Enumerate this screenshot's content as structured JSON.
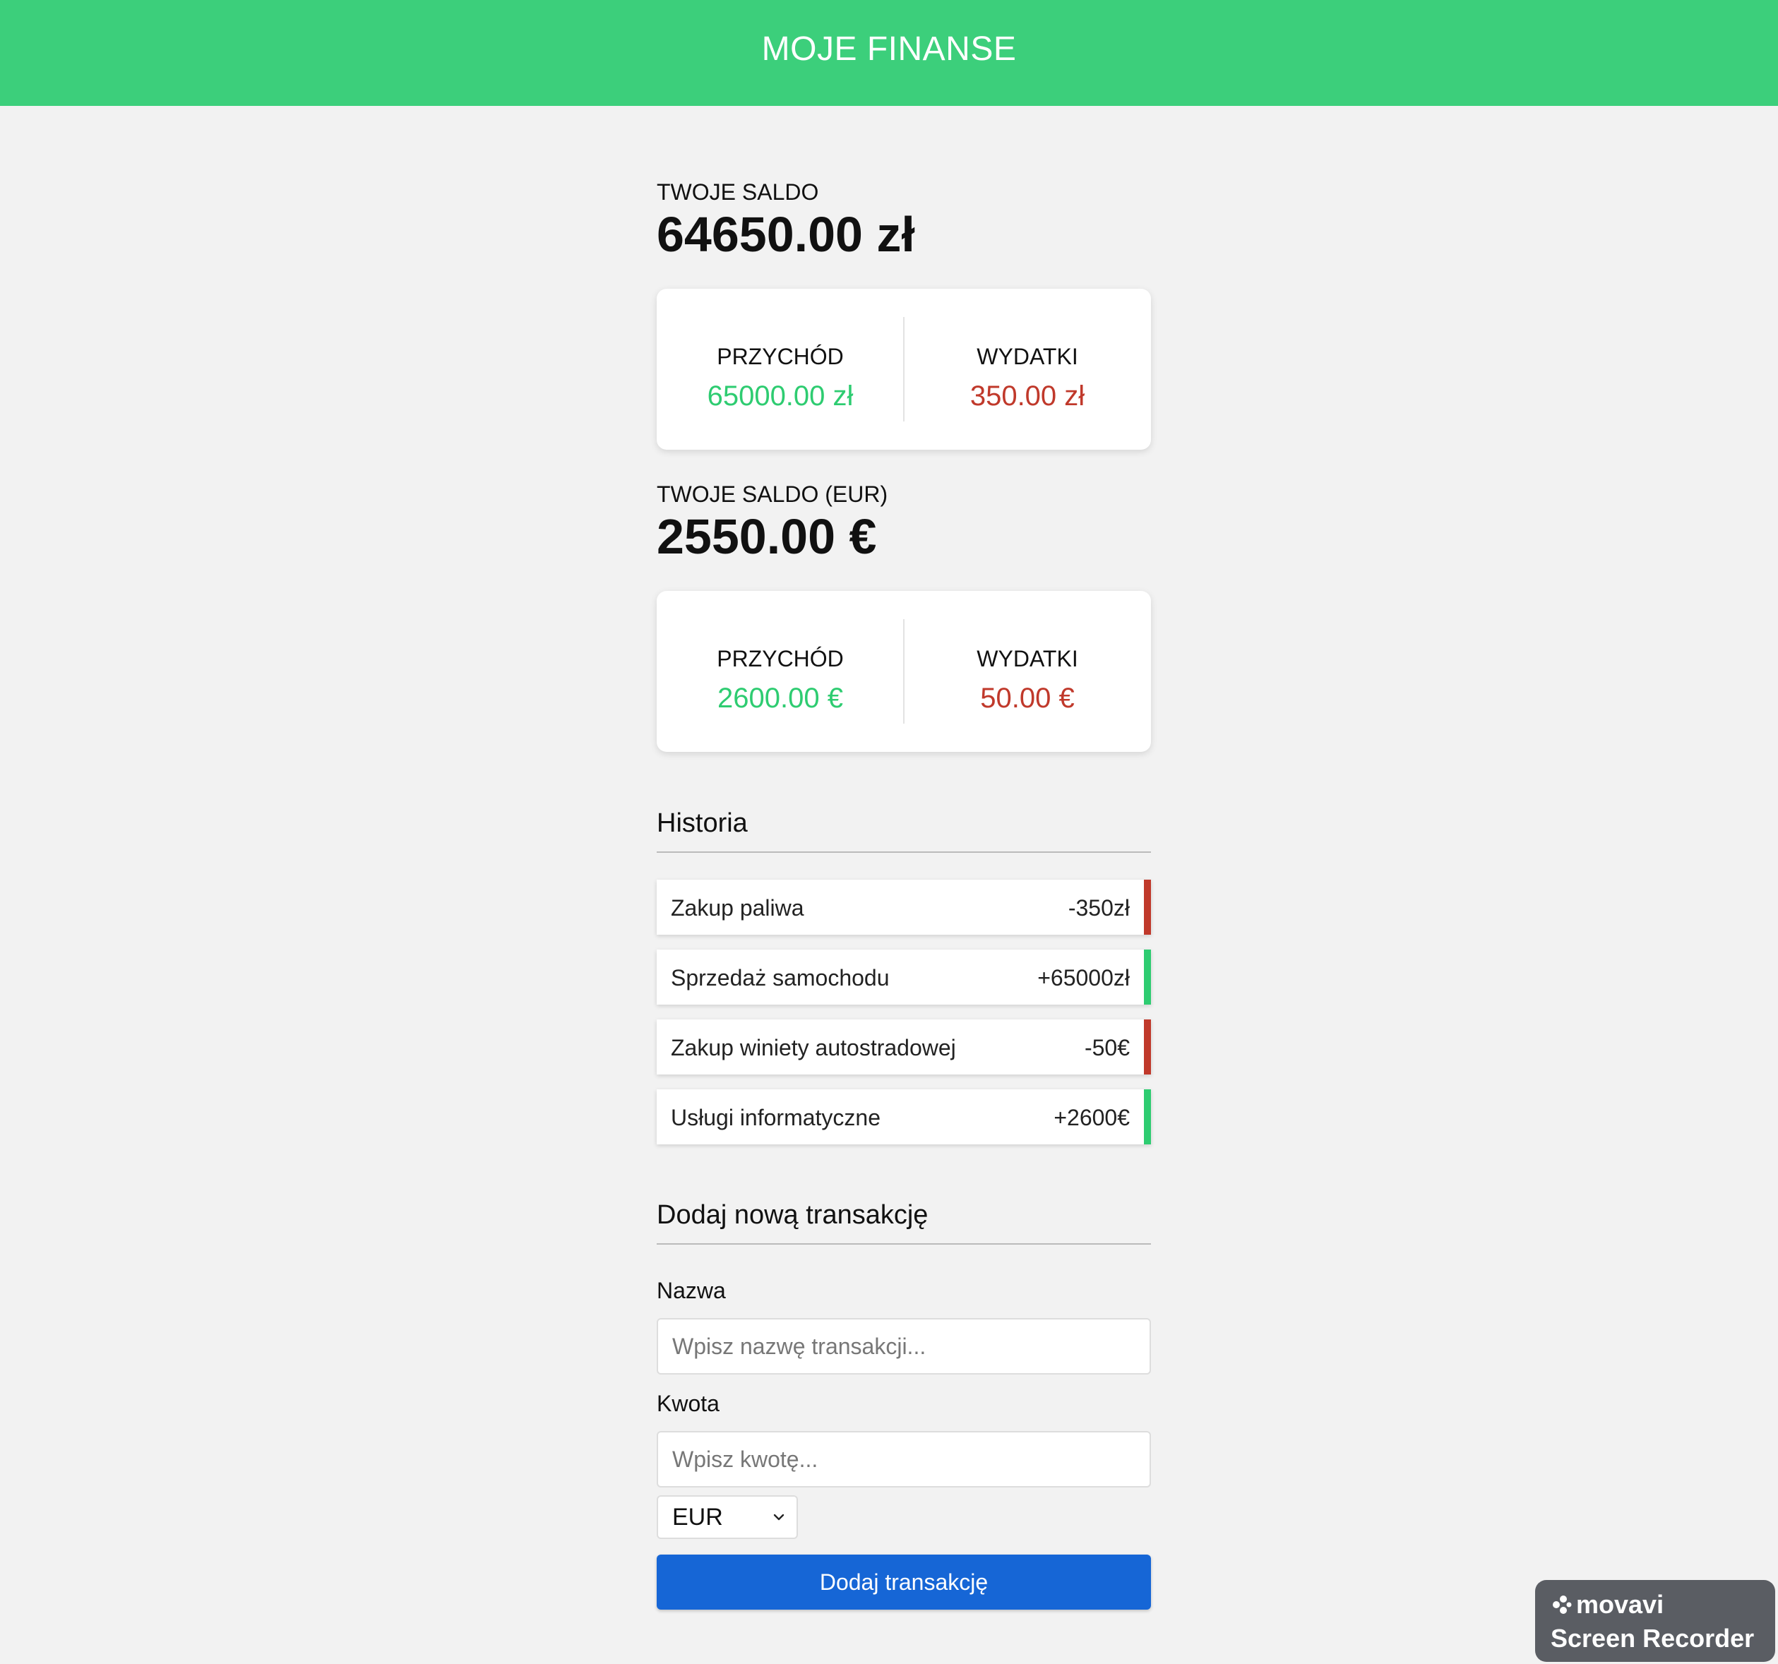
{
  "header": {
    "title": "MOJE FINANSE"
  },
  "pln": {
    "balance_label": "TWOJE SALDO",
    "balance_value": "64650.00 zł",
    "income_label": "PRZYCHÓD",
    "income_value": "65000.00 zł",
    "expense_label": "WYDATKI",
    "expense_value": "350.00 zł"
  },
  "eur": {
    "balance_label": "TWOJE SALDO (EUR)",
    "balance_value": "2550.00 €",
    "income_label": "PRZYCHÓD",
    "income_value": "2600.00 €",
    "expense_label": "WYDATKI",
    "expense_value": "50.00 €"
  },
  "history": {
    "title": "Historia",
    "items": [
      {
        "name": "Zakup paliwa",
        "amount": "-350zł",
        "type": "minus"
      },
      {
        "name": "Sprzedaż samochodu",
        "amount": "+65000zł",
        "type": "plus"
      },
      {
        "name": "Zakup winiety autostradowej",
        "amount": "-50€",
        "type": "minus"
      },
      {
        "name": "Usługi informatyczne",
        "amount": "+2600€",
        "type": "plus"
      }
    ]
  },
  "form": {
    "title": "Dodaj nową transakcję",
    "name_label": "Nazwa",
    "name_placeholder": "Wpisz nazwę transakcji...",
    "amount_label": "Kwota",
    "amount_placeholder": "Wpisz kwotę...",
    "currency_value": "EUR",
    "submit_label": "Dodaj transakcję"
  },
  "watermark": {
    "brand": "movavi",
    "product": "Screen Recorder"
  },
  "colors": {
    "header": "#3ccf7b",
    "income": "#2ecc71",
    "expense": "#c0392b",
    "button": "#1666d6"
  }
}
